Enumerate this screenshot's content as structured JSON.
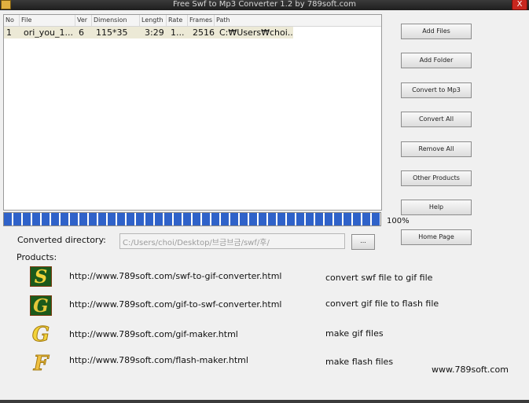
{
  "window": {
    "title": "Free Swf to Mp3 Converter 1.2 by 789soft.com",
    "close_label": "X"
  },
  "file_list": {
    "columns": [
      "No",
      "File",
      "Ver",
      "Dimension",
      "Length",
      "Rate",
      "Frames",
      "Path"
    ],
    "rows": [
      {
        "no": "1",
        "file": "ori_you_1...",
        "ver": "6",
        "dimension": "115*35",
        "length": "3:29",
        "rate": "1...",
        "frames": "2516",
        "path": "C:₩Users₩choi..."
      }
    ]
  },
  "progress": {
    "value": 1.0,
    "label": "100%",
    "fill_color": "#2f62c9"
  },
  "buttons": [
    "Add Files",
    "Add Folder",
    "Convert to Mp3",
    "Convert All",
    "Remove All",
    "Other Products",
    "Help",
    "Home Page"
  ],
  "converted_directory": {
    "label": "Converted directory:",
    "value": "C:/Users/choi/Desktop/브금브금/swf/후/",
    "browse_label": "..."
  },
  "products": {
    "label": "Products:",
    "items": [
      {
        "logo_letter": "S",
        "icon": "swf-to-gif-logo",
        "url": "http://www.789soft.com/swf-to-gif-converter.html",
        "description": "convert swf file to gif file"
      },
      {
        "logo_letter": "G",
        "icon": "gif-to-swf-logo",
        "url": "http://www.789soft.com/gif-to-swf-converter.html",
        "description": "convert gif file to flash file"
      },
      {
        "logo_letter": "G",
        "icon": "gif-maker-logo",
        "url": "http://www.789soft.com/gif-maker.html",
        "description": "make gif files"
      },
      {
        "logo_letter": "F",
        "icon": "flash-maker-logo",
        "url": "http://www.789soft.com/flash-maker.html",
        "description": "make flash files"
      }
    ]
  },
  "footer": {
    "site": "www.789soft.com"
  }
}
